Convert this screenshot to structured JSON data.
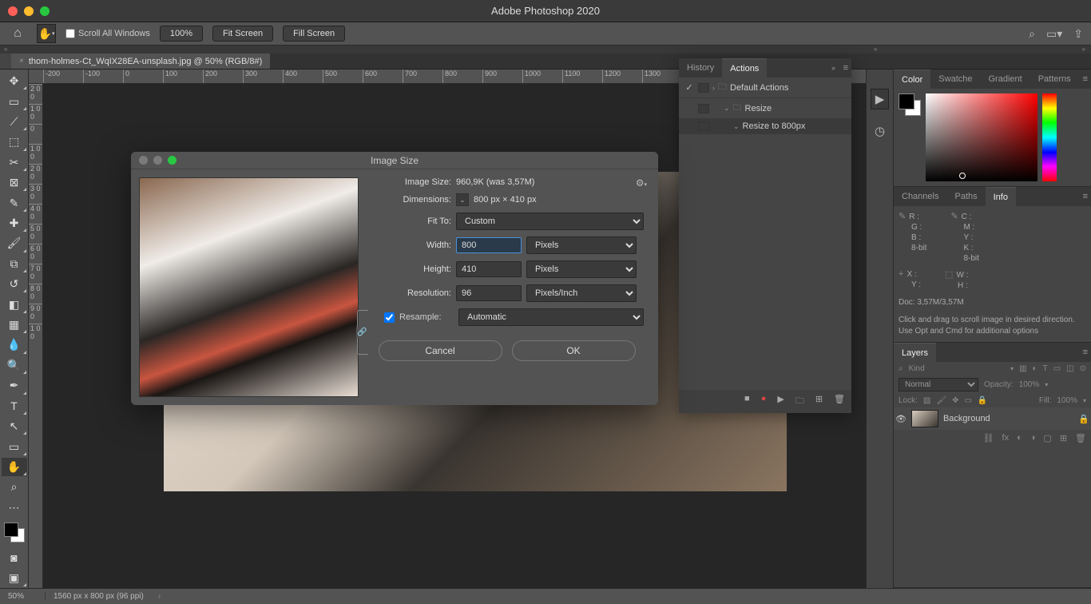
{
  "app": {
    "title": "Adobe Photoshop 2020"
  },
  "optionbar": {
    "scroll_all": "Scroll All Windows",
    "zoom_pct": "100%",
    "fit_screen": "Fit Screen",
    "fill_screen": "Fill Screen"
  },
  "tab": {
    "filename": "thom-holmes-Ct_WqIX28EA-unsplash.jpg @ 50% (RGB/8#)"
  },
  "ruler_h": [
    "-200",
    "-100",
    "0",
    "100",
    "200",
    "300",
    "400",
    "500",
    "600",
    "700",
    "800",
    "900",
    "1000",
    "1100",
    "1200",
    "1300"
  ],
  "ruler_v": [
    "2 0 0",
    "1 0 0",
    "0",
    "1 0 0",
    "2 0 0",
    "3 0 0",
    "4 0 0",
    "5 0 0",
    "6 0 0",
    "7 0 0",
    "8 0 0",
    "9 0 0",
    "1 0 0"
  ],
  "dialog": {
    "title": "Image Size",
    "image_size_label": "Image Size:",
    "image_size_value": "960,9K (was 3,57M)",
    "dimensions_label": "Dimensions:",
    "dimensions_value": "800 px  ×  410 px",
    "fit_to_label": "Fit To:",
    "fit_to_value": "Custom",
    "width_label": "Width:",
    "width_value": "800",
    "width_unit": "Pixels",
    "height_label": "Height:",
    "height_value": "410",
    "height_unit": "Pixels",
    "resolution_label": "Resolution:",
    "resolution_value": "96",
    "resolution_unit": "Pixels/Inch",
    "resample_label": "Resample:",
    "resample_value": "Automatic",
    "cancel": "Cancel",
    "ok": "OK"
  },
  "actions_panel": {
    "tab_history": "History",
    "tab_actions": "Actions",
    "items": [
      {
        "label": "Default Actions"
      },
      {
        "label": "Resize"
      },
      {
        "label": "Resize to 800px"
      }
    ]
  },
  "color_panel": {
    "tabs": [
      "Color",
      "Swatche",
      "Gradient",
      "Patterns"
    ]
  },
  "info_panel": {
    "tabs": [
      "Channels",
      "Paths",
      "Info"
    ],
    "rgb": {
      "r": "R :",
      "g": "G :",
      "b": "B :",
      "bit": "8-bit"
    },
    "cmyk": {
      "c": "C :",
      "m": "M :",
      "y": "Y :",
      "k": "K :",
      "bit": "8-bit"
    },
    "xy": {
      "x": "X :",
      "y": "Y :"
    },
    "wh": {
      "w": "W :",
      "h": "H :"
    },
    "doc": "Doc: 3,57M/3,57M",
    "hint": "Click and drag to scroll image in desired direction.  Use Opt and Cmd for additional options"
  },
  "layers_panel": {
    "tab": "Layers",
    "kind": "Kind",
    "blend": "Normal",
    "opacity_label": "Opacity:",
    "opacity_value": "100%",
    "lock_label": "Lock:",
    "fill_label": "Fill:",
    "fill_value": "100%",
    "layer_name": "Background"
  },
  "status": {
    "zoom": "50%",
    "info": "1560 px x 800 px (96 ppi)"
  }
}
